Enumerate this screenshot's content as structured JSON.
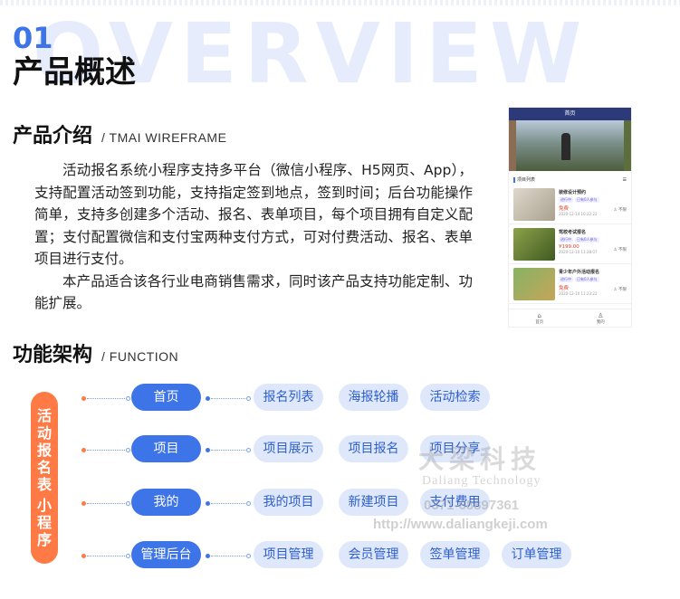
{
  "header": {
    "bg_word": "OVERVIEW",
    "number": "01",
    "title": "产品概述"
  },
  "intro_section": {
    "title": "产品介绍",
    "subtitle": "/ TMAI WIREFRAME",
    "paragraphs": [
      "活动报名系统小程序支持多平台（微信小程序、H5网页、App），支持配置活动签到功能，支持指定签到地点，签到时间；后台功能操作简单，支持多创建多个活动、报名、表单项目，每个项目拥有自定义配置；支付配置微信和支付宝两种支付方式，可对付费活动、报名、表单项目进行支付。",
      "本产品适合该各行业电商销售需求，同时该产品支持功能定制、功能扩展。"
    ]
  },
  "phone": {
    "title": "首页",
    "list_title": "项目列表",
    "list_more": "☰",
    "items": [
      {
        "name": "装修设计预约",
        "tags": [
          "进行中",
          "已有0人参与"
        ],
        "price": "免费",
        "date": "2020-12-14 16:22:22",
        "limit": "不限"
      },
      {
        "name": "驾校考试报名",
        "tags": [
          "进行中",
          "已有0人参与"
        ],
        "price": "¥199.00",
        "date": "2020-12-10 11:28:07",
        "limit": "不限"
      },
      {
        "name": "青少年户外活动报名",
        "tags": [
          "进行中",
          "已有0人参与"
        ],
        "price": "免费",
        "date": "2020-12-10 11:23:22",
        "limit": "不限"
      }
    ],
    "tabs": [
      {
        "icon": "⌂",
        "label": "首页"
      },
      {
        "icon": "♙",
        "label": "我的"
      }
    ]
  },
  "function_section": {
    "title": "功能架构",
    "subtitle": "/ FUNCTION",
    "vertical_label_a": "活动报名表",
    "vertical_label_b": "小程序",
    "rows": [
      {
        "main": "首页",
        "subs": [
          "报名列表",
          "海报轮播",
          "活动检索"
        ]
      },
      {
        "main": "项目",
        "subs": [
          "项目展示",
          "项目报名",
          "项目分享"
        ]
      },
      {
        "main": "我的",
        "subs": [
          "我的项目",
          "新建项目",
          "支付费用"
        ]
      },
      {
        "main": "管理后台",
        "subs": [
          "项目管理",
          "会员管理",
          "签单管理",
          "订单管理"
        ]
      }
    ]
  },
  "watermark": {
    "logo": "大梁科技",
    "en": "Daliang Technology",
    "phone": "0371-68897361",
    "url": "http://www.daliangkeji.com"
  }
}
